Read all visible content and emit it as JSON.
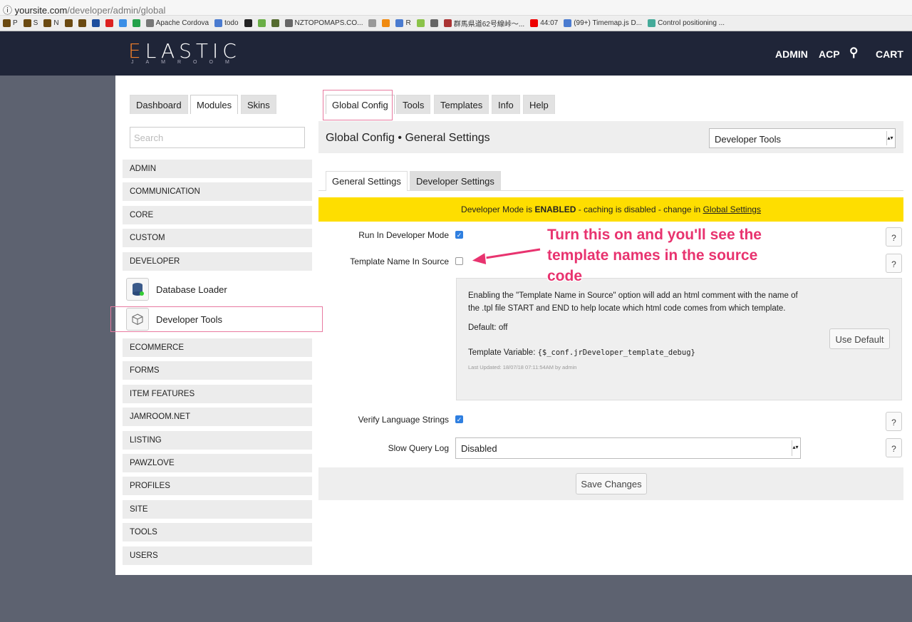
{
  "browser": {
    "url_host": "yoursite.com",
    "url_path": "/developer/admin/global",
    "bookmarks": [
      {
        "label": "P",
        "color": "#6b4a12"
      },
      {
        "label": "S",
        "color": "#6b4a12"
      },
      {
        "label": "N",
        "color": "#6b4a12"
      },
      {
        "label": "",
        "color": "#6b4a12"
      },
      {
        "label": "",
        "color": "#6b4a12"
      },
      {
        "label": "",
        "color": "#1d4e9e"
      },
      {
        "label": "",
        "color": "#d22"
      },
      {
        "label": "",
        "color": "#3a8ee6"
      },
      {
        "label": "",
        "color": "#23a14a"
      },
      {
        "label": "Apache Cordova",
        "color": "#777"
      },
      {
        "label": "todo",
        "color": "#4a7bd0"
      },
      {
        "label": "",
        "color": "#222"
      },
      {
        "label": "",
        "color": "#6aae46"
      },
      {
        "label": "",
        "color": "#556b2f"
      },
      {
        "label": "NZTOPOMAPS.CO...",
        "color": "#666"
      },
      {
        "label": "",
        "color": "#999"
      },
      {
        "label": "",
        "color": "#f08a10"
      },
      {
        "label": "R",
        "color": "#4a7bd0"
      },
      {
        "label": "",
        "color": "#8bc34a"
      },
      {
        "label": "",
        "color": "#666"
      },
      {
        "label": "群馬県道62号線峠〜...",
        "color": "#a33"
      },
      {
        "label": "44:07",
        "color": "#e00"
      },
      {
        "label": "(99+) Timemap.js D...",
        "color": "#4a7bd0"
      },
      {
        "label": "Control positioning ...",
        "color": "#4a9"
      }
    ]
  },
  "header": {
    "logo": "ELASTIC",
    "logo_sub": "JAMROOM",
    "nav": [
      "ADMIN",
      "ACP",
      "CART"
    ]
  },
  "left": {
    "tabs": [
      "Dashboard",
      "Modules",
      "Skins"
    ],
    "search_placeholder": "Search",
    "categories_top": [
      "ADMIN",
      "COMMUNICATION",
      "CORE",
      "CUSTOM",
      "DEVELOPER"
    ],
    "modules": [
      "Database Loader",
      "Developer Tools"
    ],
    "categories_bottom": [
      "ECOMMERCE",
      "FORMS",
      "ITEM FEATURES",
      "JAMROOM.NET",
      "LISTING",
      "PAWZLOVE",
      "PROFILES",
      "SITE",
      "TOOLS",
      "USERS"
    ]
  },
  "right": {
    "tabs": [
      "Global Config",
      "Tools",
      "Templates",
      "Info",
      "Help"
    ],
    "title": "Global Config • General Settings",
    "module_select": "Developer Tools",
    "subtabs": [
      "General Settings",
      "Developer Settings"
    ],
    "notice_pre": "Developer Mode is ",
    "notice_bold": "ENABLED",
    "notice_mid": " - caching is disabled - change in ",
    "notice_link": "Global Settings",
    "settings": [
      {
        "label": "Run In Developer Mode",
        "checked": true
      },
      {
        "label": "Template Name In Source",
        "checked": false
      },
      {
        "label": "Verify Language Strings",
        "checked": true
      }
    ],
    "info": {
      "text": "Enabling the \"Template Name in Source\" option will add an html comment with the name of the .tpl file START and END to help locate which html code comes from which template.",
      "default": "Default: off",
      "var_label": "Template Variable: ",
      "var_value": "{$_conf.jrDeveloper_template_debug}",
      "updated": "Last Updated: 18/07/18 07:11:54AM by admin",
      "use_default": "Use Default"
    },
    "slow_query_label": "Slow Query Log",
    "slow_query_value": "Disabled",
    "help": "?",
    "save": "Save Changes"
  },
  "annotation": {
    "lines": [
      "Turn this on and you'll see the",
      "template names in the source",
      "code"
    ],
    "color": "#e8336f"
  }
}
